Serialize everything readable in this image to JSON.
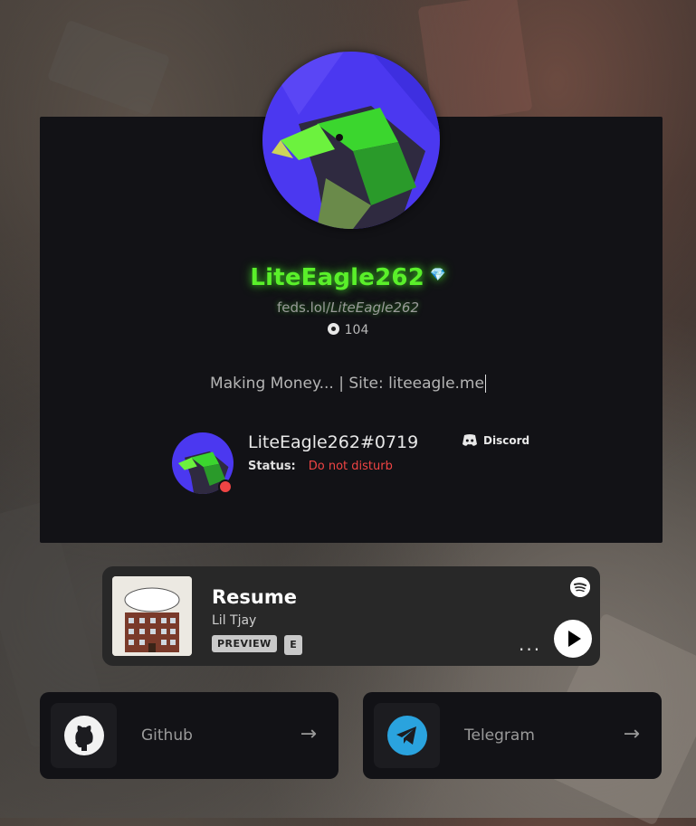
{
  "profile": {
    "username": "LiteEagle262",
    "badge_icon": "diamond-icon",
    "url_prefix": "feds.lol/",
    "url_name": "LiteEagle262",
    "views": "104",
    "bio": "Making Money... | Site: liteeagle.me"
  },
  "discord": {
    "tag": "LiteEagle262#0719",
    "status_label": "Status:",
    "status_value": "Do not disturb",
    "brand": "Discord"
  },
  "spotify": {
    "track": "Resume",
    "artist": "Lil Tjay",
    "preview_label": "PREVIEW",
    "explicit_label": "E",
    "more": "..."
  },
  "links": [
    {
      "label": "Github",
      "icon": "github-icon"
    },
    {
      "label": "Telegram",
      "icon": "telegram-icon"
    }
  ],
  "colors": {
    "username": "#5af02a",
    "dnd": "#f04444",
    "card": "#121216",
    "telegram": "#2aa3de"
  }
}
